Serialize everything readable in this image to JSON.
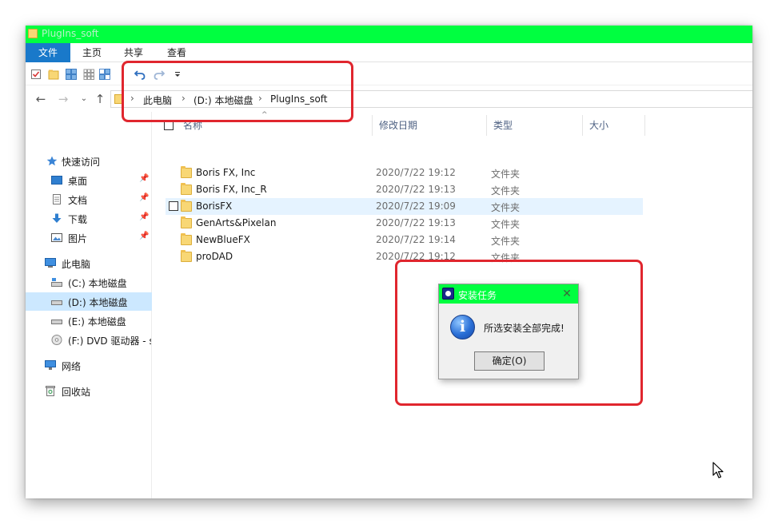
{
  "window": {
    "title": "PlugIns_soft",
    "accent_color": "#00ff40",
    "file_tab_color": "#1979ca"
  },
  "ribbon": {
    "tabs": [
      {
        "label": "文件",
        "active": true
      },
      {
        "label": "主页"
      },
      {
        "label": "共享"
      },
      {
        "label": "查看"
      }
    ]
  },
  "quick_access": {
    "icons": [
      "properties-icon",
      "new-folder-icon",
      "view-large-icon",
      "view-small-icon",
      "view-details-icon",
      "undo-icon",
      "redo-icon",
      "customize-dropdown-icon"
    ]
  },
  "address": {
    "breadcrumbs": [
      "此电脑",
      "(D:) 本地磁盘",
      "PlugIns_soft"
    ]
  },
  "sidebar": {
    "quick_access": {
      "label": "快速访问"
    },
    "quick_items": [
      {
        "label": "桌面",
        "pinned": true
      },
      {
        "label": "文档",
        "pinned": true
      },
      {
        "label": "下载",
        "pinned": true
      },
      {
        "label": "图片",
        "pinned": true
      }
    ],
    "this_pc": {
      "label": "此电脑"
    },
    "drives": [
      {
        "label": "(C:) 本地磁盘"
      },
      {
        "label": "(D:) 本地磁盘",
        "selected": true
      },
      {
        "label": "(E:) 本地磁盘"
      },
      {
        "label": "(F:) DVD 驱动器 - s"
      }
    ],
    "network": {
      "label": "网络"
    },
    "recycle_bin": {
      "label": "回收站"
    }
  },
  "columns": {
    "name": "名称",
    "date": "修改日期",
    "type": "类型",
    "size": "大小"
  },
  "files": [
    {
      "name": "Boris FX, Inc",
      "date": "2020/7/22 19:12",
      "type": "文件夹"
    },
    {
      "name": "Boris FX, Inc_R",
      "date": "2020/7/22 19:13",
      "type": "文件夹"
    },
    {
      "name": "BorisFX",
      "date": "2020/7/22 19:09",
      "type": "文件夹",
      "hover": true
    },
    {
      "name": "GenArts&Pixelan",
      "date": "2020/7/22 19:13",
      "type": "文件夹"
    },
    {
      "name": "NewBlueFX",
      "date": "2020/7/22 19:14",
      "type": "文件夹"
    },
    {
      "name": "proDAD",
      "date": "2020/7/22 19:12",
      "type": "文件夹"
    }
  ],
  "dialog": {
    "title": "安装任务",
    "message": "所选安装全部完成!",
    "ok_label": "确定(O)",
    "icon": "info-icon",
    "close_symbol": "✕",
    "info_glyph": "i"
  },
  "annotation_color": "#e0262e"
}
